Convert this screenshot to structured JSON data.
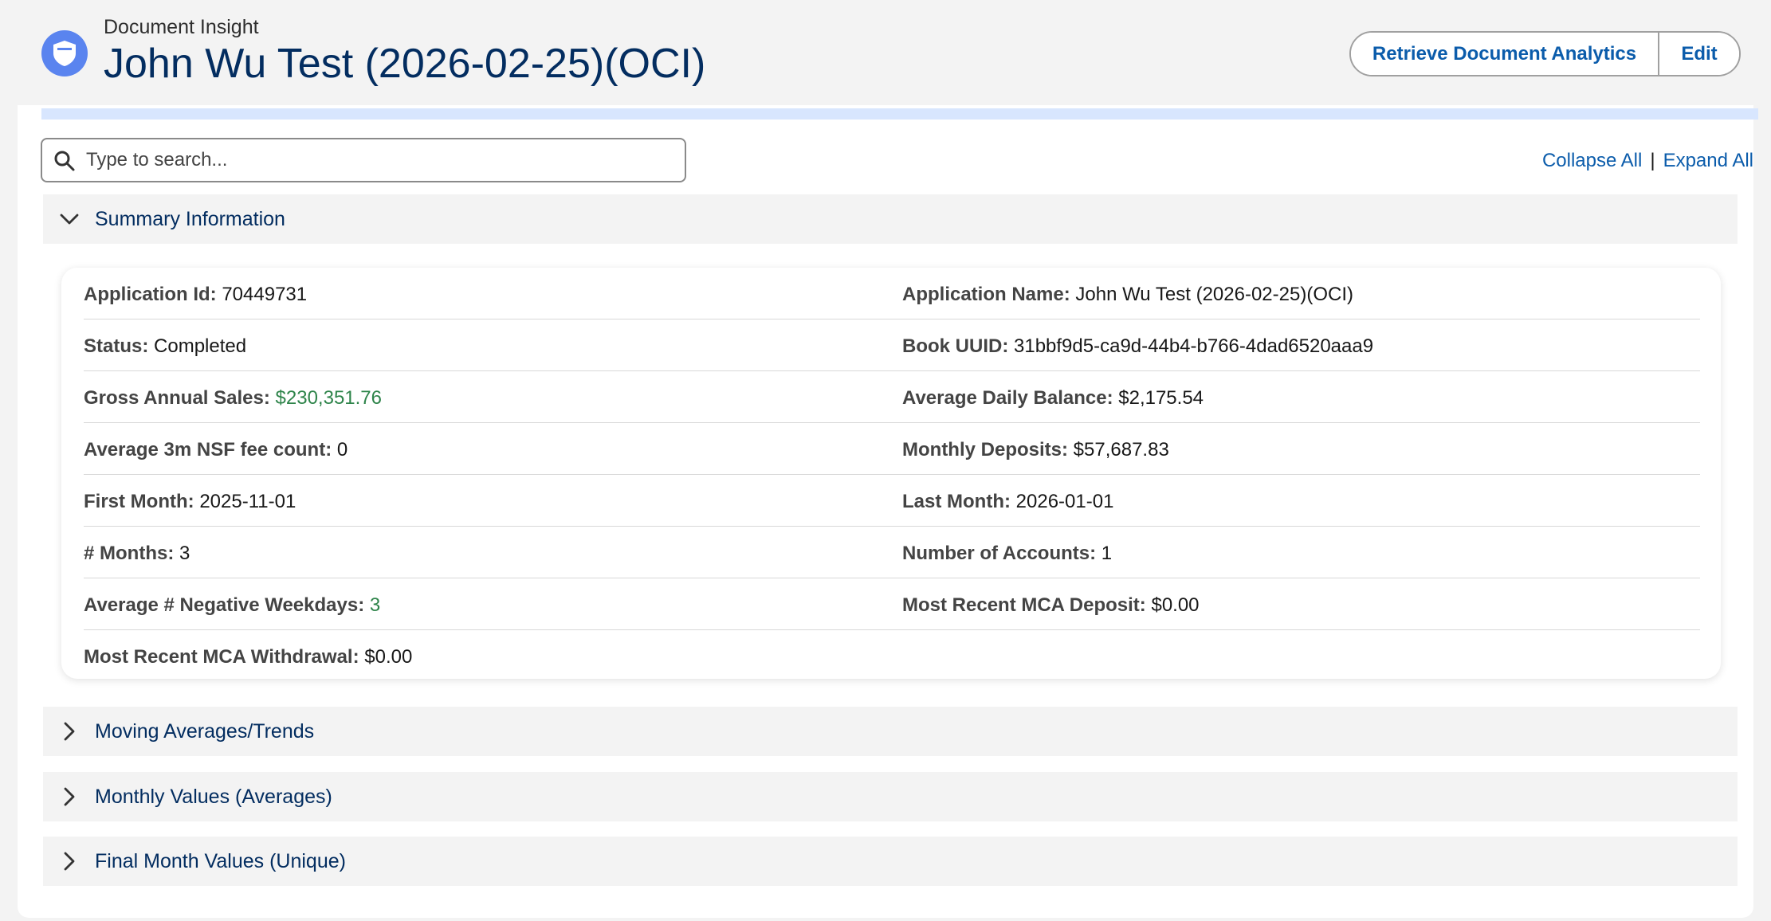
{
  "header": {
    "object_type": "Document Insight",
    "title": "John Wu Test (2026-02-25)(OCI)",
    "icon": "badge-shield-icon",
    "actions": {
      "retrieve_label": "Retrieve Document Analytics",
      "edit_label": "Edit"
    }
  },
  "toolbar": {
    "search_placeholder": "Type to search...",
    "collapse_all": "Collapse All",
    "separator": "|",
    "expand_all": "Expand All"
  },
  "sections": [
    {
      "label": "Summary Information",
      "expanded": true
    },
    {
      "label": "Moving Averages/Trends",
      "expanded": false
    },
    {
      "label": "Monthly Values (Averages)",
      "expanded": false
    },
    {
      "label": "Final Month Values (Unique)",
      "expanded": false
    }
  ],
  "summary": {
    "rows": [
      {
        "left": {
          "label": "Application Id:",
          "value": "70449731"
        },
        "right": {
          "label": "Application Name:",
          "value": "John Wu Test (2026-02-25)(OCI)"
        }
      },
      {
        "left": {
          "label": "Status:",
          "value": "Completed"
        },
        "right": {
          "label": "Book UUID:",
          "value": "31bbf9d5-ca9d-44b4-b766-4dad6520aaa9"
        }
      },
      {
        "left": {
          "label": "Gross Annual Sales:",
          "value": "$230,351.76"
        },
        "right": {
          "label": "Average Daily Balance:",
          "value": "$2,175.54"
        }
      },
      {
        "left": {
          "label": "Average 3m NSF fee count:",
          "value": "0"
        },
        "right": {
          "label": "Monthly Deposits:",
          "value": "$57,687.83"
        }
      },
      {
        "left": {
          "label": "First Month:",
          "value": "2025-11-01"
        },
        "right": {
          "label": "Last Month:",
          "value": "2026-01-01"
        }
      },
      {
        "left": {
          "label": "# Months:",
          "value": "3"
        },
        "right": {
          "label": "Number of Accounts:",
          "value": "1"
        }
      },
      {
        "left": {
          "label": "Average # Negative Weekdays:",
          "value": "3"
        },
        "right": {
          "label": "Most Recent MCA Deposit:",
          "value": "$0.00"
        }
      },
      {
        "left": {
          "label": "Most Recent MCA Withdrawal:",
          "value": "$0.00"
        }
      }
    ]
  },
  "colors": {
    "brand_blue": "#0b5cab",
    "title_navy": "#032d60",
    "positive_green": "#2e844a",
    "icon_blue": "#5a84ef"
  }
}
